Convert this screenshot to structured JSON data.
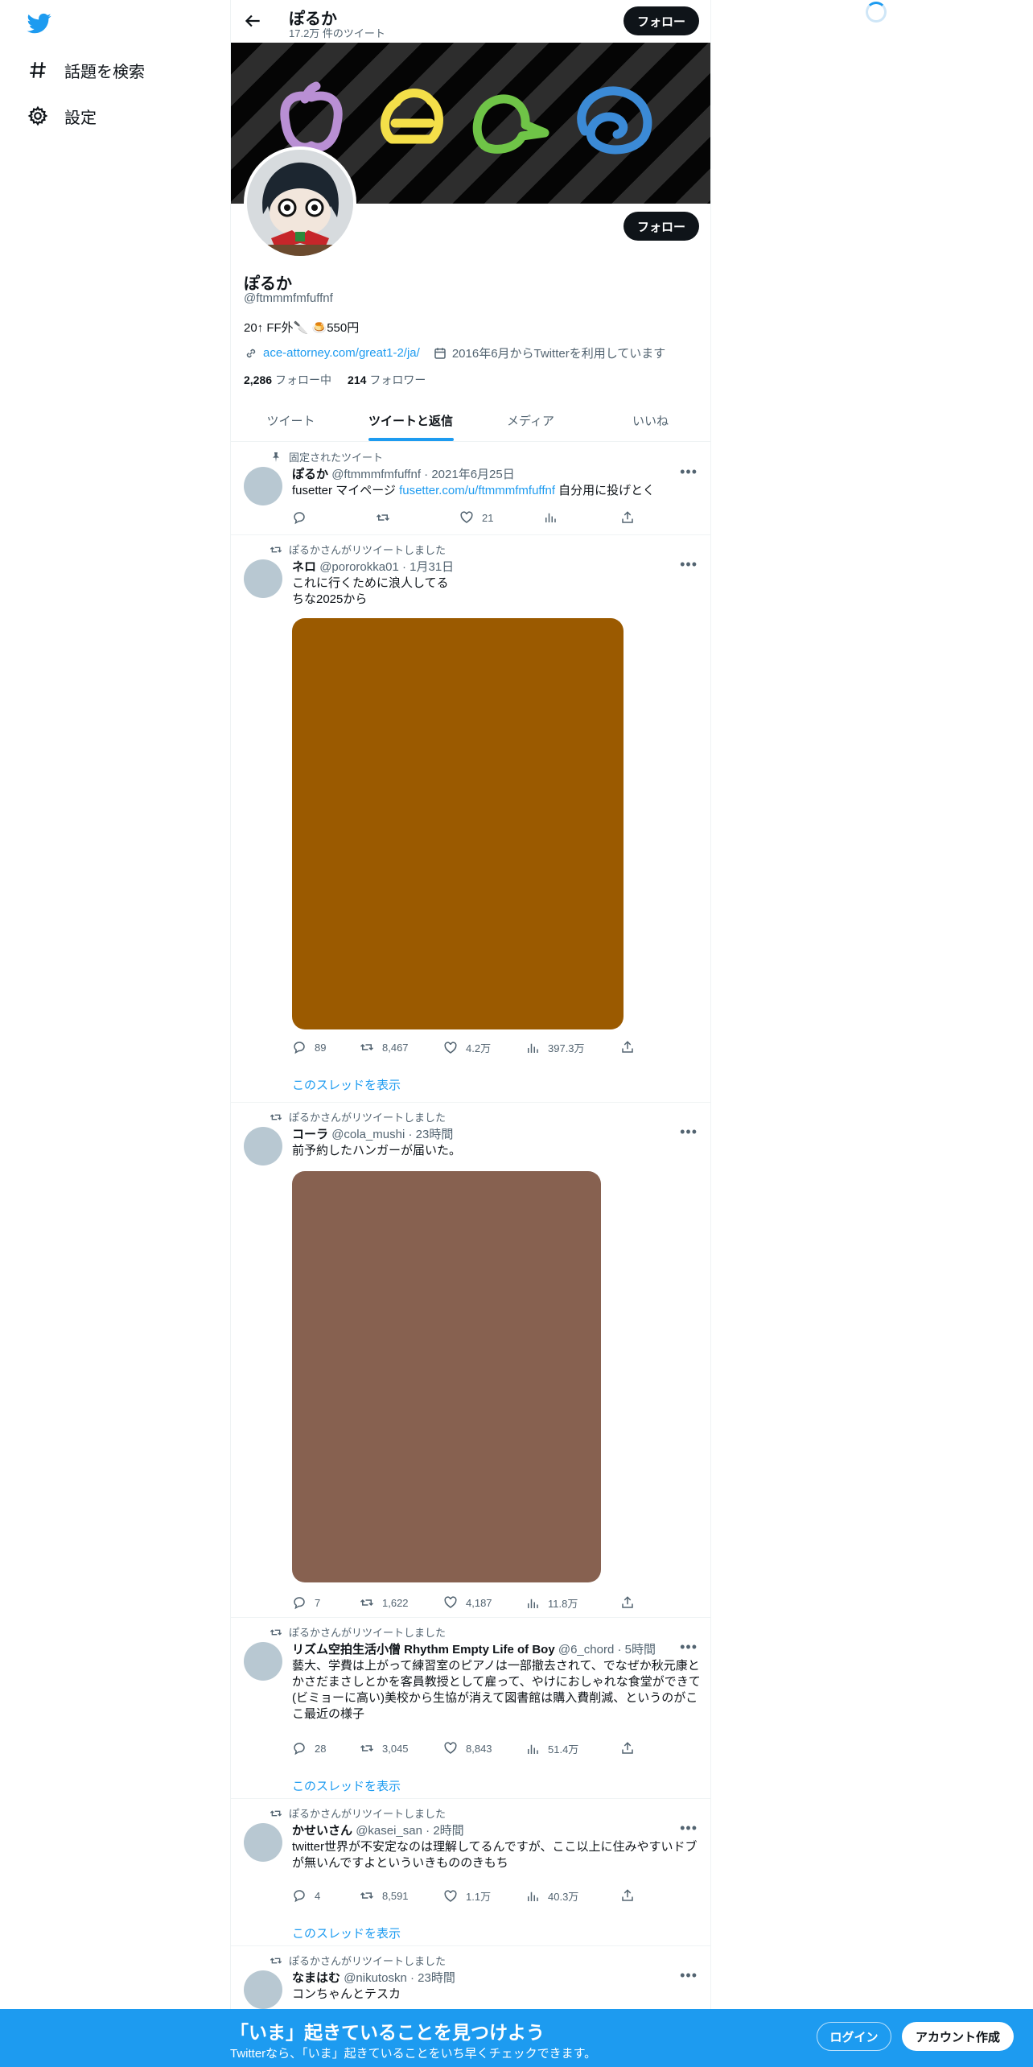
{
  "nav": {
    "explore": "話題を検索",
    "settings": "設定"
  },
  "colors": {
    "accent": "#1d9bf0",
    "dark": "#0f1419",
    "secondary": "#536471"
  },
  "header": {
    "title": "ぽるか",
    "tweet_count": "17.2万 件のツイート",
    "follow": "フォロー"
  },
  "profile": {
    "name": "ぽるか",
    "handle": "@ftmmmfmfuffnf",
    "bio": "20↑ FF外🔪 🍮550円",
    "website": "ace-attorney.com/great1-2/ja/",
    "joined": "2016年6月からTwitterを利用しています",
    "following_count": "2,286",
    "following_label": "フォロー中",
    "followers_count": "214",
    "followers_label": "フォロワー",
    "follow": "フォロー"
  },
  "tabs": [
    "ツイート",
    "ツイートと返信",
    "メディア",
    "いいね"
  ],
  "tweets": [
    {
      "context": "固定されたツイート",
      "name": "ぽるか",
      "handle": "@ftmmmfmfuffnf",
      "dot": "·",
      "time": "2021年6月25日",
      "text_before": "fusetter マイページ ",
      "link": "fusetter.com/u/ftmmmfmfuffnf",
      "text_after": " 自分用に投げとく",
      "replies": "",
      "retweets": "",
      "likes": "21",
      "views": ""
    },
    {
      "context": "ぽるかさんがリツイートしました",
      "name": "ネロ",
      "handle": "@pororokka01",
      "dot": "·",
      "time": "1月31日",
      "text": "これに行くために浪人してる\nちな2025から",
      "media_color": "#9b5a00",
      "replies": "89",
      "retweets": "8,467",
      "likes": "4.2万",
      "views": "397.3万",
      "thread": "このスレッドを表示"
    },
    {
      "context": "ぽるかさんがリツイートしました",
      "name": "コーラ",
      "handle": "@cola_mushi",
      "dot": "·",
      "time": "23時間",
      "text": "前予約したハンガーが届いた。",
      "media_color": "#876150",
      "replies": "7",
      "retweets": "1,622",
      "likes": "4,187",
      "views": "11.8万"
    },
    {
      "context": "ぽるかさんがリツイートしました",
      "name": "リズム空拍生活小僧 Rhythm Empty Life of Boy",
      "handle": "@6_chord",
      "dot": "·",
      "time": "5時間",
      "text": "藝大、学費は上がって練習室のピアノは一部撤去されて、でなぜか秋元康とかさだまさしとかを客員教授として雇って、やけにおしゃれな食堂ができて(ビミョーに高い)美校から生協が消えて図書館は購入費削減、というのがここ最近の様子",
      "replies": "28",
      "retweets": "3,045",
      "likes": "8,843",
      "views": "51.4万",
      "thread": "このスレッドを表示"
    },
    {
      "context": "ぽるかさんがリツイートしました",
      "name": "かせいさん",
      "handle": "@kasei_san",
      "dot": "·",
      "time": "2時間",
      "text": "twitter世界が不安定なのは理解してるんですが、ここ以上に住みやすいドブが無いんですよといういきもののきもち",
      "replies": "4",
      "retweets": "8,591",
      "likes": "1.1万",
      "views": "40.3万",
      "thread": "このスレッドを表示"
    },
    {
      "context": "ぽるかさんがリツイートしました",
      "name": "なまはむ",
      "handle": "@nikutoskn",
      "dot": "·",
      "time": "23時間",
      "text": "コンちゃんとテスカ"
    }
  ],
  "bottom": {
    "title": "「いま」起きていることを見つけよう",
    "sub": "Twitterなら、「いま」起きていることをいち早くチェックできます。",
    "login": "ログイン",
    "signup": "アカウント作成"
  }
}
